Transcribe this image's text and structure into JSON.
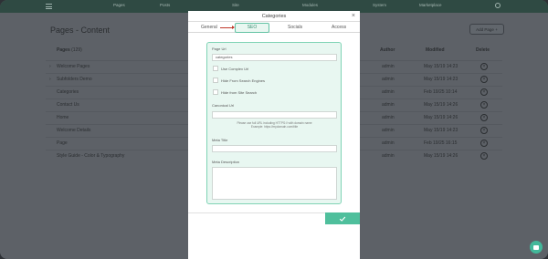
{
  "nav": {
    "items": [
      "Pages",
      "Posts",
      "Site",
      "Modules",
      "System",
      "Marketplace"
    ]
  },
  "page": {
    "title": "Pages - Content",
    "add_page_label": "Add Page",
    "columns": {
      "pages": "Pages",
      "pages_count": "(129)",
      "author": "Author",
      "modified": "Modified",
      "delete": "Delete"
    },
    "rows": [
      {
        "name": "Welcome Pages",
        "author": "admin",
        "modified": "May 15/19 14:23"
      },
      {
        "name": "Subfolders Demo",
        "author": "admin",
        "modified": "May 15/19 14:23"
      },
      {
        "name": "Categories",
        "author": "admin",
        "modified": "Feb 19/25 10:14"
      },
      {
        "name": "Contact Us",
        "author": "admin",
        "modified": "May 15/19 14:26"
      },
      {
        "name": "Home",
        "author": "admin",
        "modified": "May 15/19 14:26"
      },
      {
        "name": "Welcome Details",
        "author": "admin",
        "modified": "May 15/19 14:23"
      },
      {
        "name": "Page",
        "author": "admin",
        "modified": "Feb 19/25 16:15"
      },
      {
        "name": "Style Guide - Color & Typography",
        "author": "admin",
        "modified": "May 15/19 14:26"
      }
    ]
  },
  "modal": {
    "title": "Categories",
    "close": "×",
    "tabs": {
      "general": "General",
      "seo": "SEO",
      "socials": "Socials",
      "access": "Access"
    },
    "page_url_label": "Page Url",
    "page_url_value": "categories",
    "checkboxes": [
      "Use Complex Url",
      "Hide From Search Engines",
      "Hide from Site Search"
    ],
    "canonical_label": "Canonical Url",
    "canonical_hint_1": "Please use full URL including HTTPS:// with domain name",
    "canonical_hint_2": "Example: https://mydomain.com/title",
    "meta_title_label": "Meta Title",
    "meta_description_label": "Meta Description"
  },
  "colors": {
    "accent": "#4fbf9c",
    "arrow": "#c0392b"
  }
}
